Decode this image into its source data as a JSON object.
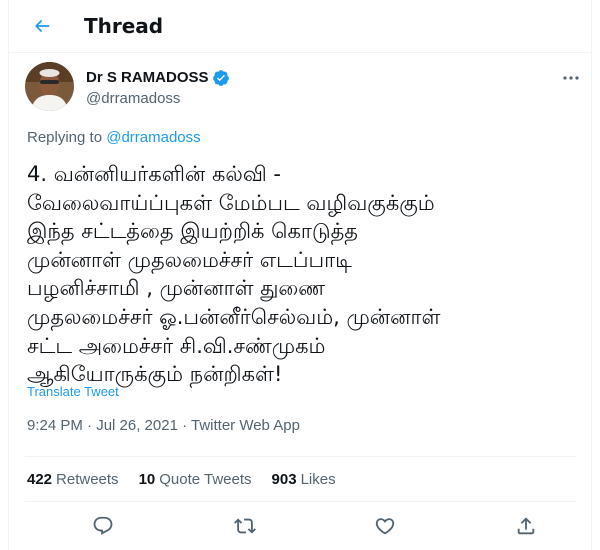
{
  "header": {
    "title": "Thread"
  },
  "author": {
    "name": "Dr S RAMADOSS",
    "handle": "@drramadoss"
  },
  "replying": {
    "prefix": "Replying to",
    "handle": "@drramadoss"
  },
  "tweet": {
    "text": "4. வன்னியர்களின் கல்வி -\nவேலைவாய்ப்புகள் மேம்பட வழிவகுக்கும்\nஇந்த சட்டத்தை இயற்றிக் கொடுத்த\nமுன்னாள் முதலமைச்சர் எடப்பாடி\nபழனிச்சாமி , முன்னாள் துணை\nமுதலமைச்சர் ஓ.பன்னீர்செல்வம், முன்னாள்\nசட்ட அமைச்சர் சி.வி.சண்முகம்\nஆகியோருக்கும் நன்றிகள்!",
    "translate_label": "Translate Tweet",
    "timestamp": "9:24 PM · Jul 26, 2021 · Twitter Web App"
  },
  "stats": [
    {
      "count": "422",
      "label": "Retweets"
    },
    {
      "count": "10",
      "label": "Quote Tweets"
    },
    {
      "count": "903",
      "label": "Likes"
    }
  ],
  "icons": {
    "back": "arrow-left-icon",
    "verified": "verified-badge-icon",
    "more": "more-horizontal-icon",
    "reply": "reply-icon",
    "retweet": "retweet-icon",
    "like": "heart-icon",
    "share": "share-icon"
  },
  "colors": {
    "accent": "#1d9bf0",
    "text": "#0f1419",
    "muted": "#536471"
  }
}
